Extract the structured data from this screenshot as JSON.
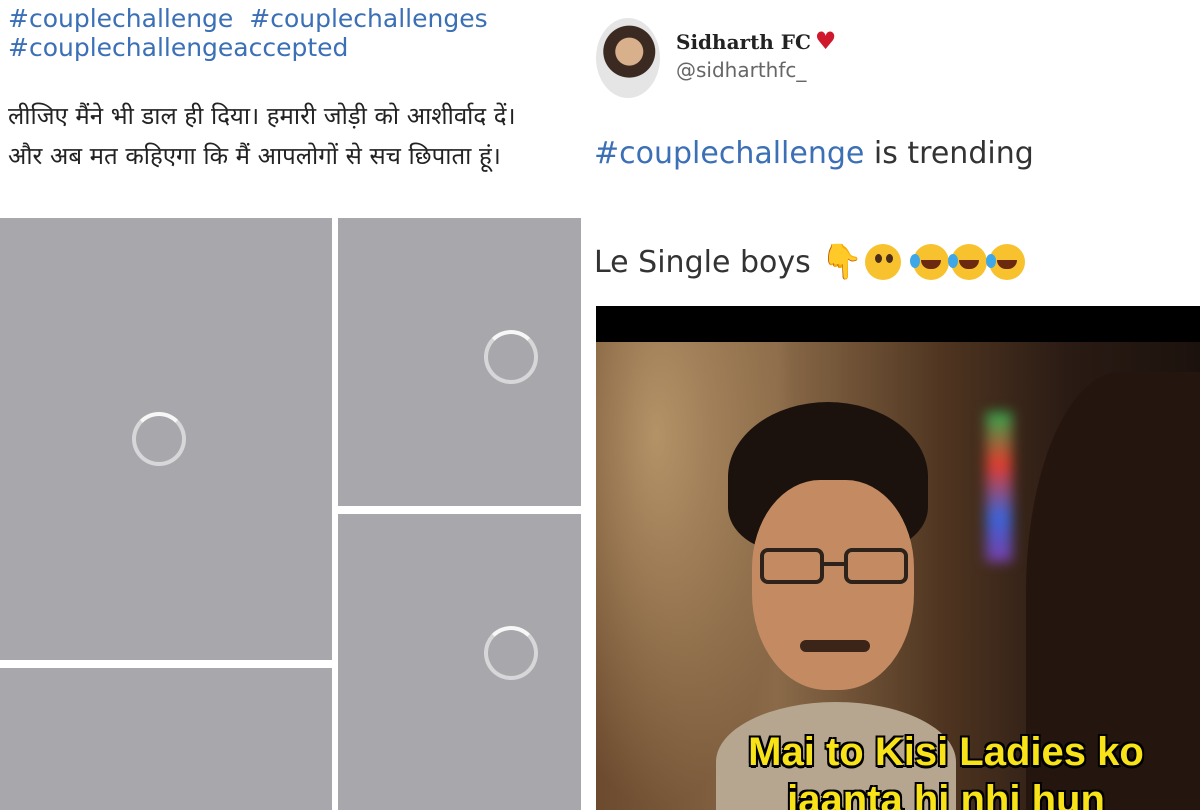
{
  "left_post": {
    "hashtags": [
      "#couplechallenge",
      "#couplechallenges",
      "#couplechallengeaccepted"
    ],
    "text_line_1": "लीजिए मैंने भी डाल ही दिया। हमारी जोड़ी को आशीर्वाद दें।",
    "text_line_2": "और अब मत कहिएगा कि मैं आपलोगों से सच छिपाता हूं।"
  },
  "right_post": {
    "author_name": "Sidharth FC",
    "handle": "@sidharthfc_",
    "hashtag": "#couplechallenge",
    "trend_text": " is trending",
    "single_text": "Le Single boys",
    "emojis": [
      "pointing-down",
      "rolling-eyes",
      "rofl",
      "rofl",
      "rofl"
    ],
    "meme_caption_line_1": "Mai to Kisi Ladies ko",
    "meme_caption_line_2": "jaanta hi nhi hun"
  },
  "colors": {
    "hashtag_blue": "#3b6fb6",
    "heart_red": "#d0182c",
    "caption_yellow": "#f7e318",
    "placeholder_gray": "#a8a8ac"
  }
}
